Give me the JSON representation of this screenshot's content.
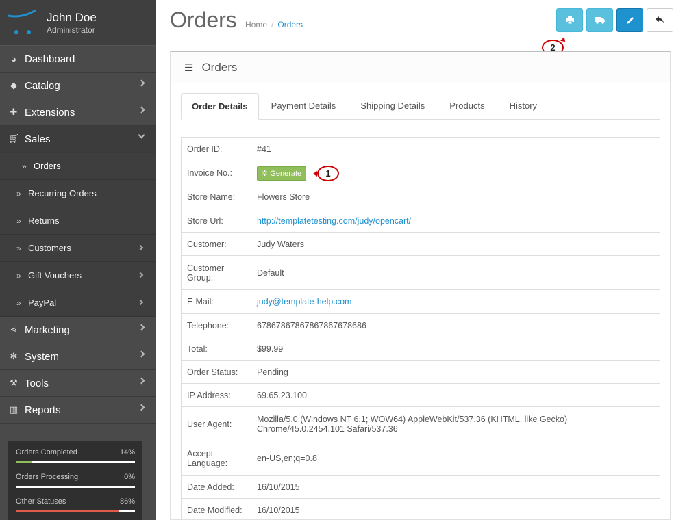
{
  "profile": {
    "name": "John Doe",
    "role": "Administrator"
  },
  "menu": [
    {
      "label": "Dashboard",
      "icon": "dashboard-icon",
      "chev": false
    },
    {
      "label": "Catalog",
      "icon": "tag-icon",
      "chev": true
    },
    {
      "label": "Extensions",
      "icon": "puzzle-icon",
      "chev": true
    },
    {
      "label": "Sales",
      "icon": "cart-icon",
      "chev": true,
      "open": true
    }
  ],
  "sales_sub": [
    {
      "label": "Orders",
      "current": true,
      "chev": false
    },
    {
      "label": "Recurring Orders",
      "chev": false
    },
    {
      "label": "Returns",
      "chev": false
    },
    {
      "label": "Customers",
      "chev": true
    },
    {
      "label": "Gift Vouchers",
      "chev": true
    },
    {
      "label": "PayPal",
      "chev": true
    }
  ],
  "menu2": [
    {
      "label": "Marketing",
      "icon": "share-icon"
    },
    {
      "label": "System",
      "icon": "cog-icon"
    },
    {
      "label": "Tools",
      "icon": "wrench-icon"
    },
    {
      "label": "Reports",
      "icon": "bar-chart-icon"
    }
  ],
  "stats": [
    {
      "label": "Orders Completed",
      "value": "14%",
      "fraction": 0.14,
      "color": "#8fbe5a"
    },
    {
      "label": "Orders Processing",
      "value": "0%",
      "fraction": 0.0,
      "color": "#5bc0de"
    },
    {
      "label": "Other Statuses",
      "value": "86%",
      "fraction": 0.86,
      "color": "#e05a4a"
    }
  ],
  "page": {
    "title": "Orders",
    "breadcrumb_home": "Home",
    "breadcrumb_current": "Orders",
    "sep": "/"
  },
  "panel": {
    "title": "Orders"
  },
  "tabs": [
    "Order Details",
    "Payment Details",
    "Shipping Details",
    "Products",
    "History"
  ],
  "callouts": {
    "one": "1",
    "two": "2"
  },
  "details": {
    "generate_label": "Generate",
    "rows": [
      {
        "label": "Order ID:",
        "value": "#41"
      },
      {
        "label": "Invoice No.:",
        "value": ""
      },
      {
        "label": "Store Name:",
        "value": "Flowers Store"
      },
      {
        "label": "Store Url:",
        "value": "http://templatetesting.com/judy/opencart/"
      },
      {
        "label": "Customer:",
        "value": "Judy Waters"
      },
      {
        "label": "Customer Group:",
        "value": "Default"
      },
      {
        "label": "E-Mail:",
        "value": "judy@template-help.com"
      },
      {
        "label": "Telephone:",
        "value": "67867867867867867678686"
      },
      {
        "label": "Total:",
        "value": "$99.99"
      },
      {
        "label": "Order Status:",
        "value": "Pending"
      },
      {
        "label": "IP Address:",
        "value": "69.65.23.100"
      },
      {
        "label": "User Agent:",
        "value": "Mozilla/5.0 (Windows NT 6.1; WOW64) AppleWebKit/537.36 (KHTML, like Gecko) Chrome/45.0.2454.101 Safari/537.36"
      },
      {
        "label": "Accept Language:",
        "value": "en-US,en;q=0.8"
      },
      {
        "label": "Date Added:",
        "value": "16/10/2015"
      },
      {
        "label": "Date Modified:",
        "value": "16/10/2015"
      }
    ]
  },
  "colors": {
    "accent": "#1e91cf",
    "info": "#5bc0de",
    "success": "#8fbe5a",
    "sidebar": "#4a4a4a",
    "callout": "#cc0000"
  }
}
